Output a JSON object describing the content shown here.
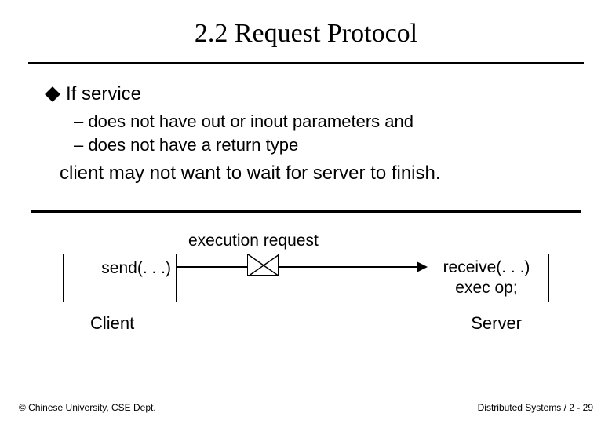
{
  "title": "2.2 Request Protocol",
  "bullet": {
    "lead": "If service"
  },
  "subbullets": [
    "does not have out or inout parameters and",
    "does not have a return type"
  ],
  "followup": "client may not want to wait for server to finish.",
  "diagram": {
    "exec_label": "execution request",
    "client_box": "send(. . .)",
    "server_box_line1": "receive(. . .)",
    "server_box_line2": "exec op;",
    "client_caption": "Client",
    "server_caption": "Server"
  },
  "footer": {
    "left": "© Chinese University, CSE Dept.",
    "right": "Distributed Systems / 2 - 29"
  }
}
